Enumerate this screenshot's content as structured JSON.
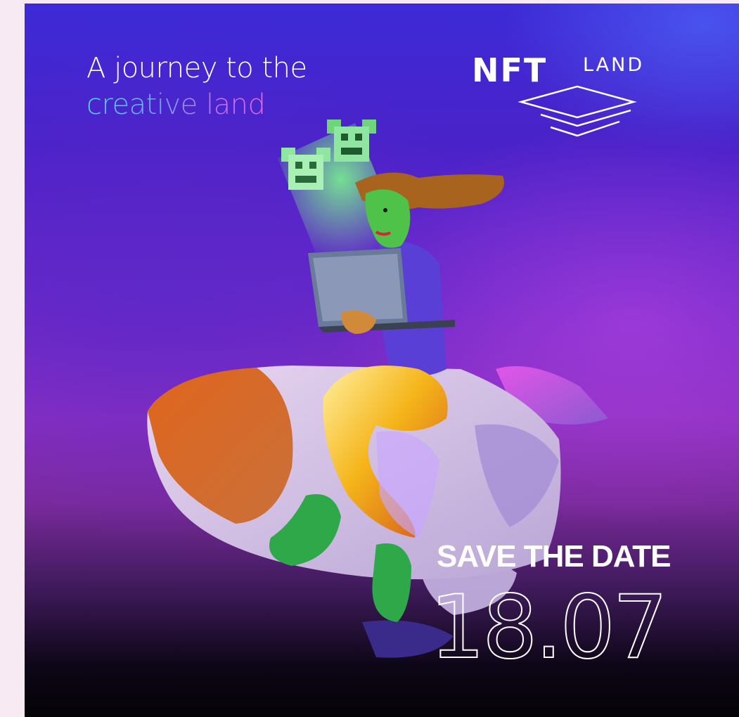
{
  "headline": {
    "line1": "A journey to the",
    "line2": "creative land"
  },
  "logo": {
    "nft": "NFT",
    "land": "LAND"
  },
  "event": {
    "save_the_date": "SAVE THE DATE",
    "date": "18.07"
  },
  "colors": {
    "background_top": "#3d2ad6",
    "background_mid": "#8a2fc0",
    "background_bottom": "#050308",
    "gradient_text_start": "#4fd6ff",
    "gradient_text_end": "#ff5fd6",
    "page_margin": "#f8eaf3"
  },
  "illustration": {
    "subject": "woman-with-laptop-riding-rocket",
    "icons": [
      "pixel-creature-icon",
      "pixel-creature-icon"
    ]
  }
}
